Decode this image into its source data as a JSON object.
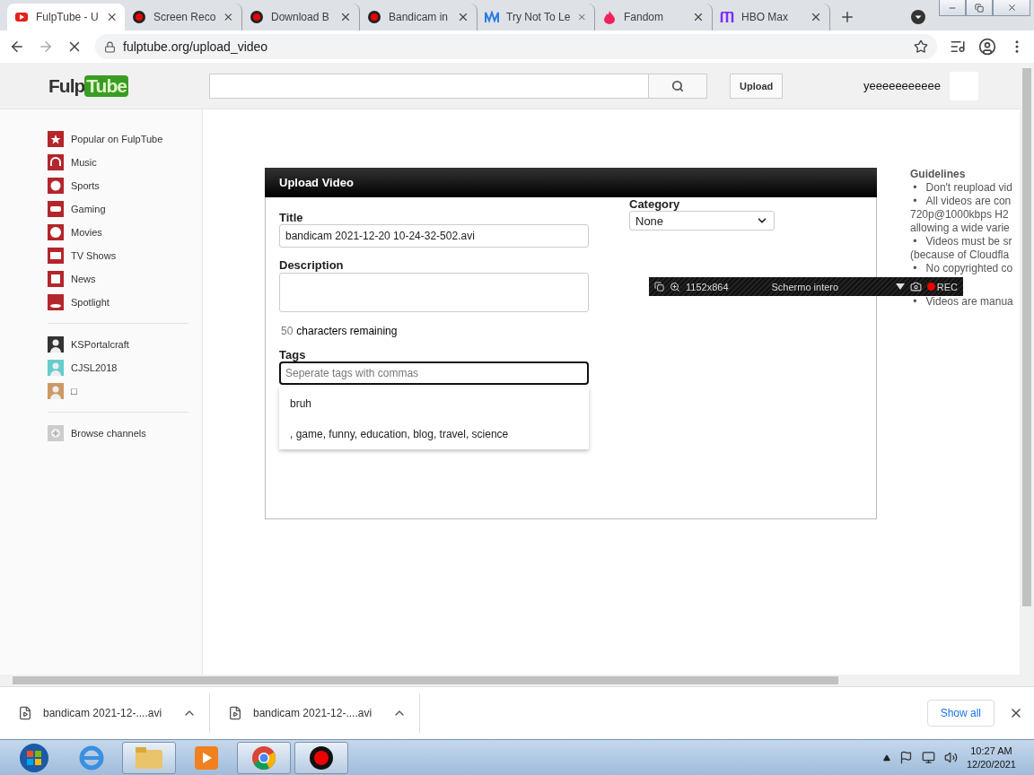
{
  "browser": {
    "tabs": [
      {
        "title": "FulpTube - U",
        "selected": true
      },
      {
        "title": "Screen Reco",
        "selected": false
      },
      {
        "title": "Download B",
        "selected": false
      },
      {
        "title": "Bandicam in",
        "selected": false
      },
      {
        "title": "Try Not To Le",
        "selected": false
      },
      {
        "title": "Fandom",
        "selected": false
      },
      {
        "title": "HBO Max",
        "selected": false
      }
    ],
    "address": "fulptube.org/upload_video"
  },
  "header": {
    "logo_left": "Fulp",
    "logo_right": "Tube",
    "upload_button": "Upload",
    "username": "yeeeeeeeeeee"
  },
  "sidebar": {
    "categories": [
      "Popular on FulpTube",
      "Music",
      "Sports",
      "Gaming",
      "Movies",
      "TV Shows",
      "News",
      "Spotlight"
    ],
    "channels": [
      "KSPortalcraft",
      "CJSL2018",
      "□"
    ],
    "browse": "Browse channels"
  },
  "upload_panel": {
    "title": "Upload Video",
    "title_label": "Title",
    "title_value": "bandicam 2021-12-20 10-24-32-502.avi",
    "description_label": "Description",
    "remaining_count": "50",
    "remaining_text": "characters remaining",
    "tags_label": "Tags",
    "tags_placeholder": "Seperate tags with commas",
    "suggestions": [
      "bruh",
      ", game, funny, education, blog, travel, science"
    ],
    "category_label": "Category",
    "category_value": "None"
  },
  "guidelines": {
    "title": "Guidelines",
    "items": [
      {
        "bullet": "•",
        "lines": [
          "Don't reupload vid"
        ]
      },
      {
        "bullet": "•",
        "lines": [
          "All videos are con",
          "720p@1000kbps H2",
          "allowing a wide varie"
        ]
      },
      {
        "bullet": "•",
        "lines": [
          "Videos must be sr",
          "(because of Cloudfla"
        ]
      },
      {
        "bullet": "•",
        "lines": [
          "No copyrighted co"
        ]
      },
      {
        "bullet": "•",
        "lines": [
          "Videos are manua"
        ]
      }
    ]
  },
  "recorder_bar": {
    "resolution": "1152x864",
    "mode": "Schermo intero",
    "rec": "REC"
  },
  "downloads": {
    "items": [
      "bandicam 2021-12-....avi",
      "bandicam 2021-12-....avi"
    ],
    "show_all": "Show all"
  },
  "taskbar": {
    "time": "10:27 AM",
    "date": "12/20/2021"
  }
}
